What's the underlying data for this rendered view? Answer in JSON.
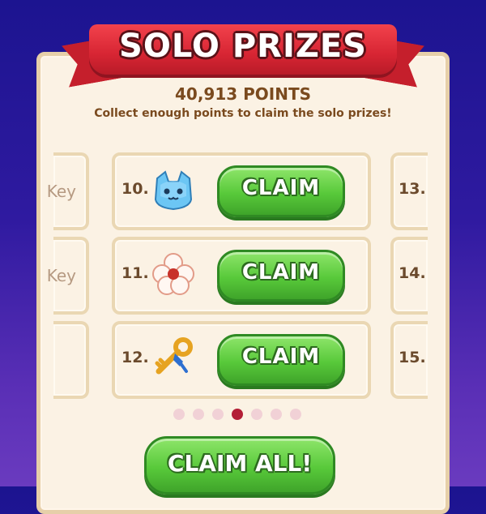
{
  "header": {
    "title": "SOLO PRIZES",
    "points": "40,913 POINTS",
    "subtitle": "Collect enough points to claim the solo prizes!"
  },
  "rows": [
    {
      "left_label": "Key",
      "number": "10.",
      "prize_icon": "blue-cat-face-icon",
      "button_label": "CLAIM",
      "right_number": "13."
    },
    {
      "left_label": "Key",
      "number": "11.",
      "prize_icon": "white-flower-icon",
      "button_label": "CLAIM",
      "right_number": "14."
    },
    {
      "left_label": "",
      "number": "12.",
      "prize_icon": "golden-key-icon",
      "button_label": "CLAIM",
      "right_number": "15."
    }
  ],
  "pagination": {
    "total_pages": 7,
    "current_page": 4
  },
  "footer": {
    "claim_all_label": "CLAIM ALL!"
  },
  "colors": {
    "background_top": "#1c1490",
    "background_bottom": "#6a3bbf",
    "banner_red": "#d72533",
    "button_green": "#58c93a",
    "text_brown": "#7a4a1e",
    "dot_active": "#b31e36",
    "dot_inactive": "#f1d1d6"
  }
}
